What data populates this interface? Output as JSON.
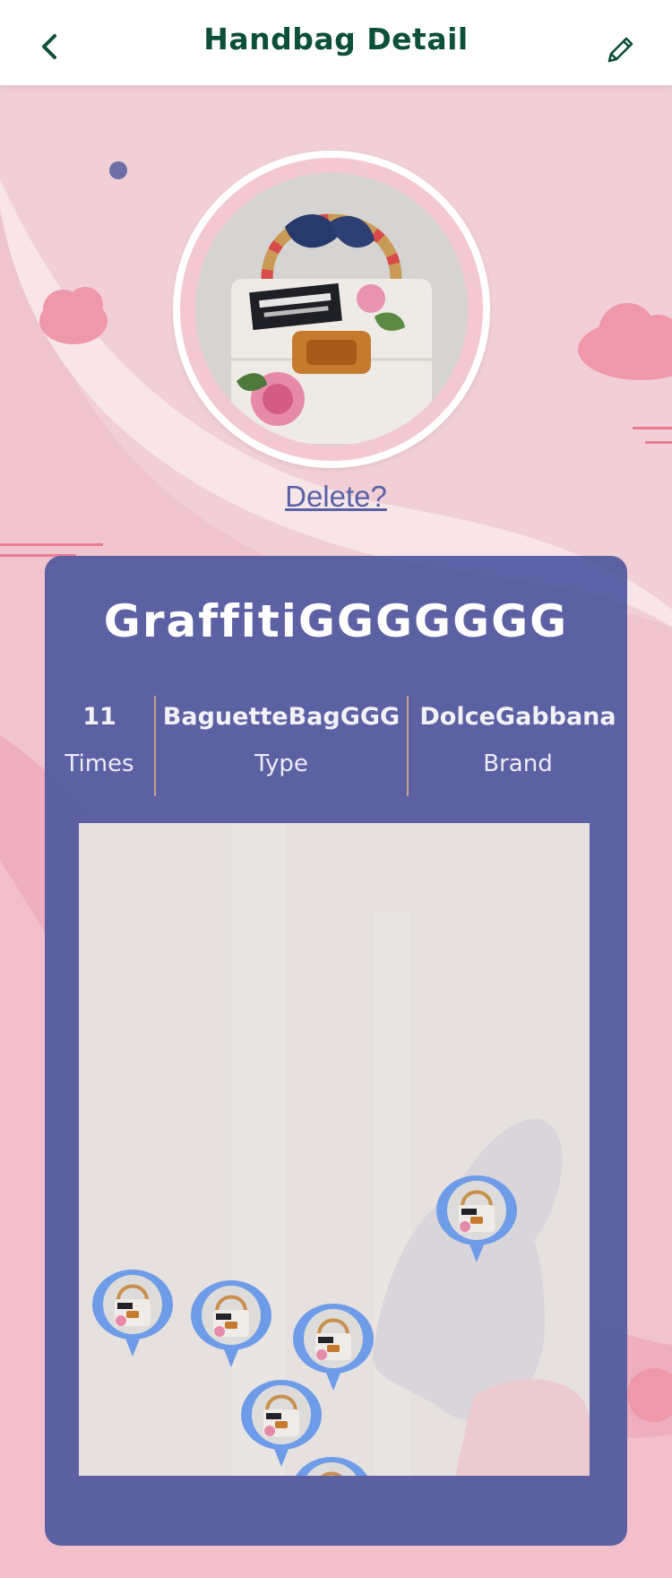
{
  "header": {
    "title": "Handbag Detail"
  },
  "avatar": {
    "subject": "handbag-photo"
  },
  "actions": {
    "delete_label": "Delete?"
  },
  "card": {
    "name": "GraffitiGGGGGGG",
    "stats": [
      {
        "value": "11",
        "label": "Times"
      },
      {
        "value": "BaguetteBagGGG",
        "label": "Type"
      },
      {
        "value": "DolceGabbana",
        "label": "Brand"
      }
    ]
  },
  "map": {
    "pin_count": 6,
    "pin_icon": "handbag-location-pin"
  },
  "colors": {
    "header_title": "#0c4f3b",
    "card_bg": "#5a62a6",
    "pin_blue": "#6e9ce8",
    "background_pink": "#f3c9d1"
  }
}
